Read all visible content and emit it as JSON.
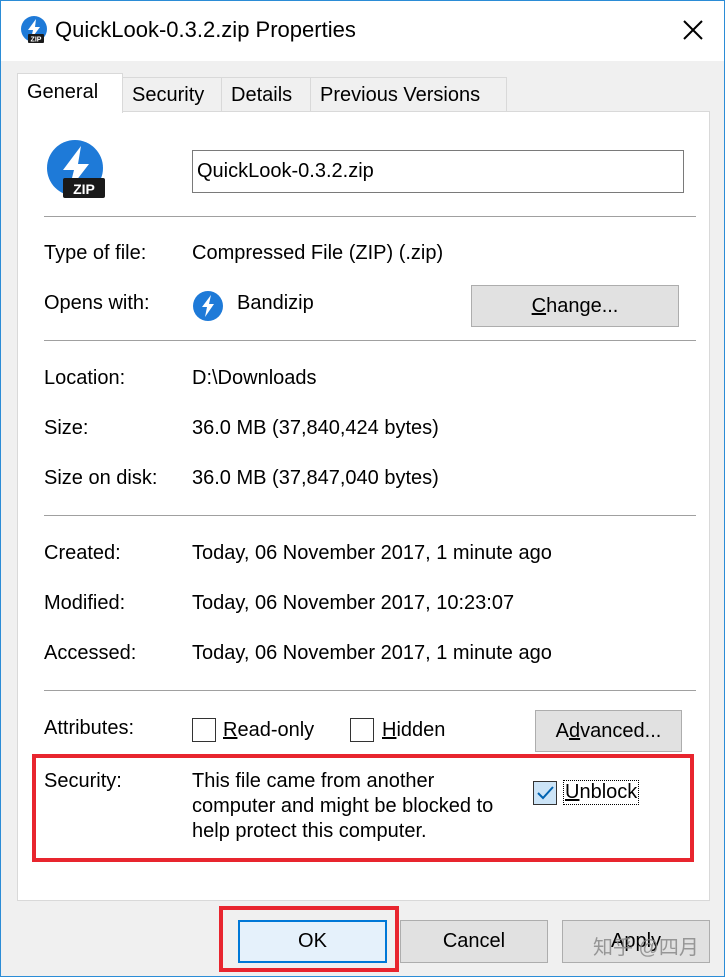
{
  "window": {
    "title": "QuickLook-0.3.2.zip Properties",
    "accent": "#2b8cd6"
  },
  "tabs": [
    {
      "label": "General",
      "active": true
    },
    {
      "label": "Security"
    },
    {
      "label": "Details"
    },
    {
      "label": "Previous Versions"
    }
  ],
  "general": {
    "file_icon_label": "ZIP",
    "filename": "QuickLook-0.3.2.zip",
    "type_label": "Type of file:",
    "type_value": "Compressed File (ZIP) (.zip)",
    "opens_label": "Opens with:",
    "opens_value": "Bandizip",
    "change_button": {
      "pre": "",
      "key": "C",
      "post": "hange..."
    },
    "location_label": "Location:",
    "location_value": "D:\\Downloads",
    "size_label": "Size:",
    "size_value": "36.0 MB (37,840,424 bytes)",
    "size_disk_label": "Size on disk:",
    "size_disk_value": "36.0 MB (37,847,040 bytes)",
    "created_label": "Created:",
    "created_value": "Today, 06 November 2017, 1 minute ago",
    "modified_label": "Modified:",
    "modified_value": "Today, 06 November 2017, 10:23:07",
    "accessed_label": "Accessed:",
    "accessed_value": "Today, 06 November 2017, 1 minute ago",
    "attributes_label": "Attributes:",
    "readonly": {
      "key": "R",
      "rest": "ead-only",
      "checked": false
    },
    "hidden": {
      "key": "H",
      "rest": "idden",
      "checked": false
    },
    "advanced_button": {
      "pre": "A",
      "key": "d",
      "post": "vanced..."
    },
    "security_label": "Security:",
    "security_text_1": "This file came from another",
    "security_text_2": "computer and might be blocked to",
    "security_text_3": "help protect this computer.",
    "unblock": {
      "key": "U",
      "rest": "nblock",
      "checked": true
    }
  },
  "footer": {
    "ok": "OK",
    "cancel": "Cancel",
    "apply": "Apply",
    "watermark": "知乎 @四月"
  },
  "highlight_color": "#e8252e"
}
